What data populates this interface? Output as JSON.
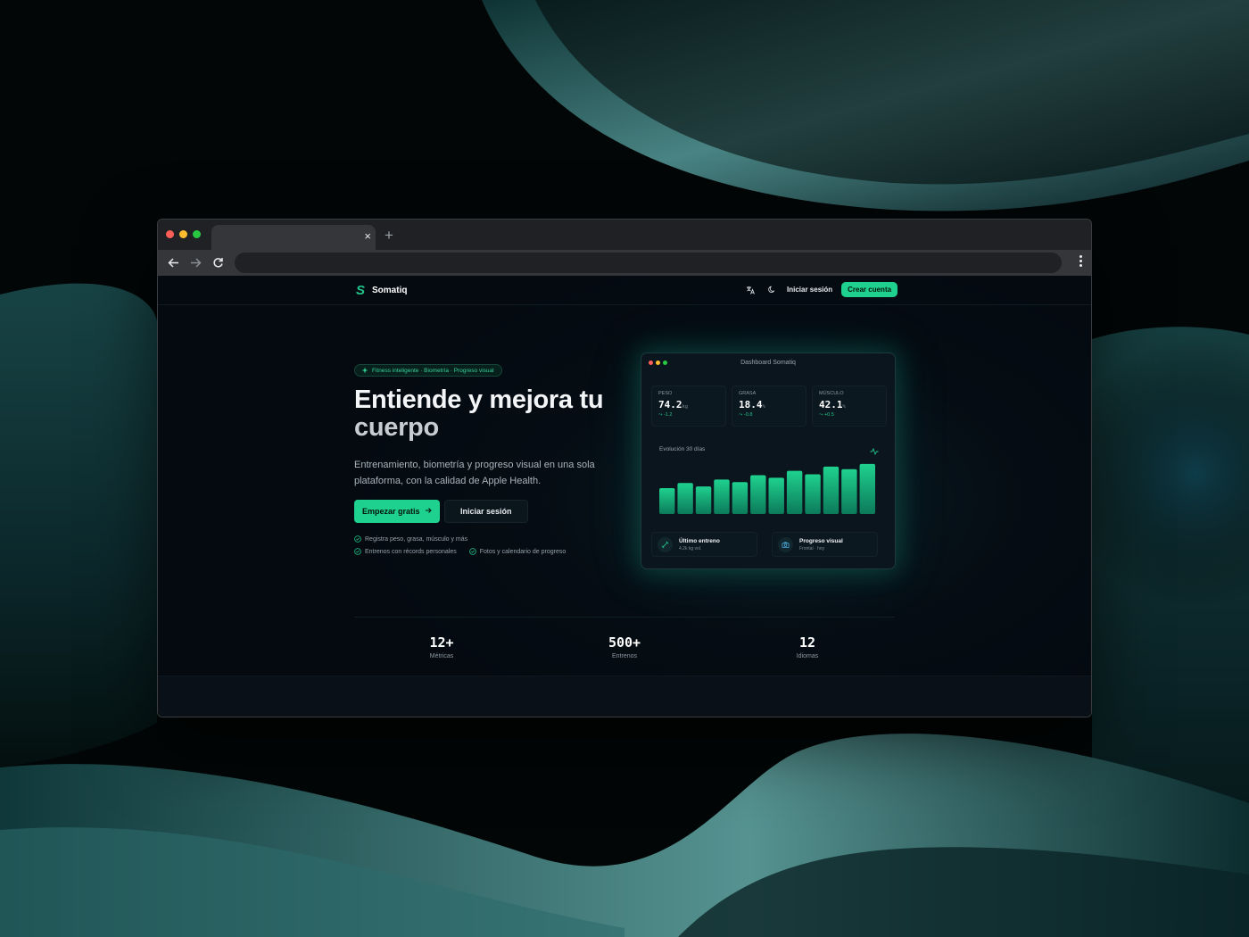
{
  "app": {
    "brand": "Somatiq",
    "brand_mark": "S",
    "accent": "#1fd18f"
  },
  "browser": {
    "tab_close": "×",
    "new_tab": "+"
  },
  "nav": {
    "login": "Iniciar sesión",
    "create_account": "Crear cuenta",
    "icons": [
      "translate-icon",
      "moon-icon"
    ]
  },
  "hero": {
    "badge": "Fitness inteligente · Biometría · Progreso visual",
    "title_line1": "Entiende y mejora tu",
    "title_line2": "cuerpo",
    "subtitle": "Entrenamiento, biometría y progreso visual en una sola plataforma, con la calidad de Apple Health.",
    "cta_primary": "Empezar gratis",
    "cta_secondary": "Iniciar sesión",
    "features": [
      "Registra peso, grasa, músculo y más",
      "Entrenos con récords personales",
      "Fotos y calendario de progreso"
    ]
  },
  "dashboard": {
    "title": "Dashboard Somatiq",
    "metrics": [
      {
        "label": "Peso",
        "value": "74.2",
        "unit": "kg",
        "delta": "-1.2"
      },
      {
        "label": "Grasa",
        "value": "18.4",
        "unit": "%",
        "delta": "-0.8"
      },
      {
        "label": "Músculo",
        "value": "42.1",
        "unit": "%",
        "delta": "+0.5"
      }
    ],
    "chart_title": "Evolución 30 días",
    "cards": [
      {
        "title": "Último entreno",
        "sub": "4.2k kg vol."
      },
      {
        "title": "Progreso visual",
        "sub": "Frontal · hoy"
      }
    ]
  },
  "chart_data": {
    "type": "bar",
    "title": "Evolución 30 días",
    "values": [
      30,
      36,
      32,
      40,
      37,
      45,
      42,
      50,
      46,
      55,
      52,
      58
    ],
    "ylim": [
      0,
      60
    ]
  },
  "stats": [
    {
      "value": "12+",
      "label": "Métricas"
    },
    {
      "value": "500+",
      "label": "Entrenos"
    },
    {
      "value": "12",
      "label": "Idiomas"
    }
  ]
}
